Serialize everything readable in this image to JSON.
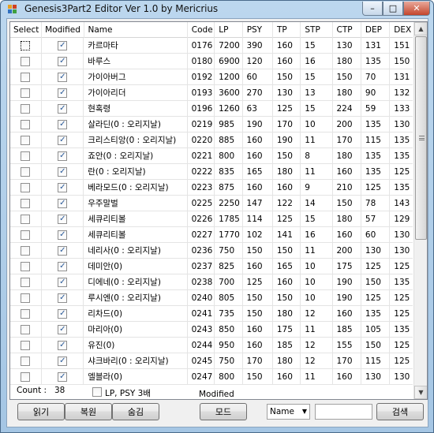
{
  "window": {
    "title": "Genesis3Part2 Editor Ver 1.0 by Mericrius",
    "controls": {
      "minimize": "–",
      "maximize": "□",
      "close": "✕"
    }
  },
  "grid": {
    "columns": [
      "Select",
      "Modified",
      "Name",
      "Code",
      "LP",
      "PSY",
      "TP",
      "STP",
      "CTP",
      "DEP",
      "DEX"
    ],
    "rows": [
      {
        "select": false,
        "modified": true,
        "name": "카르마타",
        "code": "0176",
        "lp": "7200",
        "psy": "390",
        "tp": "160",
        "stp": "15",
        "ctp": "130",
        "dep": "131",
        "dex": "151"
      },
      {
        "select": false,
        "modified": true,
        "name": "바루스",
        "code": "0180",
        "lp": "6900",
        "psy": "120",
        "tp": "160",
        "stp": "16",
        "ctp": "180",
        "dep": "135",
        "dex": "150"
      },
      {
        "select": false,
        "modified": true,
        "name": "가이아버그",
        "code": "0192",
        "lp": "1200",
        "psy": "60",
        "tp": "150",
        "stp": "15",
        "ctp": "150",
        "dep": "70",
        "dex": "131"
      },
      {
        "select": false,
        "modified": true,
        "name": "가이아리더",
        "code": "0193",
        "lp": "3600",
        "psy": "270",
        "tp": "130",
        "stp": "13",
        "ctp": "180",
        "dep": "90",
        "dex": "132"
      },
      {
        "select": false,
        "modified": true,
        "name": "현혹령",
        "code": "0196",
        "lp": "1260",
        "psy": "63",
        "tp": "125",
        "stp": "15",
        "ctp": "224",
        "dep": "59",
        "dex": "133"
      },
      {
        "select": false,
        "modified": true,
        "name": "살라딘(0 : 오리지날)",
        "code": "0219",
        "lp": "985",
        "psy": "190",
        "tp": "170",
        "stp": "10",
        "ctp": "200",
        "dep": "135",
        "dex": "130"
      },
      {
        "select": false,
        "modified": true,
        "name": "크리스티앙(0 : 오리지날)",
        "code": "0220",
        "lp": "885",
        "psy": "160",
        "tp": "190",
        "stp": "11",
        "ctp": "170",
        "dep": "115",
        "dex": "135"
      },
      {
        "select": false,
        "modified": true,
        "name": "죠안(0 : 오리지날)",
        "code": "0221",
        "lp": "800",
        "psy": "160",
        "tp": "150",
        "stp": "8",
        "ctp": "180",
        "dep": "135",
        "dex": "135"
      },
      {
        "select": false,
        "modified": true,
        "name": "란(0 : 오리지날)",
        "code": "0222",
        "lp": "835",
        "psy": "165",
        "tp": "180",
        "stp": "11",
        "ctp": "160",
        "dep": "135",
        "dex": "125"
      },
      {
        "select": false,
        "modified": true,
        "name": "베라모드(0 : 오리지날)",
        "code": "0223",
        "lp": "875",
        "psy": "160",
        "tp": "160",
        "stp": "9",
        "ctp": "210",
        "dep": "125",
        "dex": "135"
      },
      {
        "select": false,
        "modified": true,
        "name": "우주말벌",
        "code": "0225",
        "lp": "2250",
        "psy": "147",
        "tp": "122",
        "stp": "14",
        "ctp": "150",
        "dep": "78",
        "dex": "143"
      },
      {
        "select": false,
        "modified": true,
        "name": "세큐리티볼",
        "code": "0226",
        "lp": "1785",
        "psy": "114",
        "tp": "125",
        "stp": "15",
        "ctp": "180",
        "dep": "57",
        "dex": "129"
      },
      {
        "select": false,
        "modified": true,
        "name": "세큐리티볼",
        "code": "0227",
        "lp": "1770",
        "psy": "102",
        "tp": "141",
        "stp": "16",
        "ctp": "160",
        "dep": "60",
        "dex": "130"
      },
      {
        "select": false,
        "modified": true,
        "name": "네리사(0 : 오리지날)",
        "code": "0236",
        "lp": "750",
        "psy": "150",
        "tp": "150",
        "stp": "11",
        "ctp": "200",
        "dep": "130",
        "dex": "130"
      },
      {
        "select": false,
        "modified": true,
        "name": "데미안(0)",
        "code": "0237",
        "lp": "825",
        "psy": "160",
        "tp": "165",
        "stp": "10",
        "ctp": "175",
        "dep": "125",
        "dex": "125"
      },
      {
        "select": false,
        "modified": true,
        "name": "디에네(0 : 오리지날)",
        "code": "0238",
        "lp": "700",
        "psy": "125",
        "tp": "160",
        "stp": "10",
        "ctp": "190",
        "dep": "150",
        "dex": "135"
      },
      {
        "select": false,
        "modified": true,
        "name": "루시엔(0 : 오리지날)",
        "code": "0240",
        "lp": "805",
        "psy": "150",
        "tp": "150",
        "stp": "10",
        "ctp": "190",
        "dep": "125",
        "dex": "125"
      },
      {
        "select": false,
        "modified": true,
        "name": "리차드(0)",
        "code": "0241",
        "lp": "735",
        "psy": "150",
        "tp": "180",
        "stp": "12",
        "ctp": "160",
        "dep": "135",
        "dex": "125"
      },
      {
        "select": false,
        "modified": true,
        "name": "마리아(0)",
        "code": "0243",
        "lp": "850",
        "psy": "160",
        "tp": "175",
        "stp": "11",
        "ctp": "185",
        "dep": "105",
        "dex": "135"
      },
      {
        "select": false,
        "modified": true,
        "name": "유진(0)",
        "code": "0244",
        "lp": "950",
        "psy": "160",
        "tp": "185",
        "stp": "12",
        "ctp": "155",
        "dep": "150",
        "dex": "125"
      },
      {
        "select": false,
        "modified": true,
        "name": "샤크바리(0 : 오리지날)",
        "code": "0245",
        "lp": "750",
        "psy": "170",
        "tp": "180",
        "stp": "12",
        "ctp": "170",
        "dep": "115",
        "dex": "125"
      },
      {
        "select": false,
        "modified": true,
        "name": "엘블라(0)",
        "code": "0247",
        "lp": "800",
        "psy": "150",
        "tp": "160",
        "stp": "11",
        "ctp": "160",
        "dep": "130",
        "dex": "130"
      }
    ]
  },
  "footer": {
    "count_label": "Count :",
    "count_value": "38",
    "lp_psy_option": "LP, PSY 3배",
    "modified_label": "Modified",
    "buttons": {
      "read": "읽기",
      "restore": "복원",
      "hide": "숨김",
      "mode": "모드",
      "search": "검색"
    },
    "search_field": {
      "selected": "Name",
      "value": ""
    }
  }
}
